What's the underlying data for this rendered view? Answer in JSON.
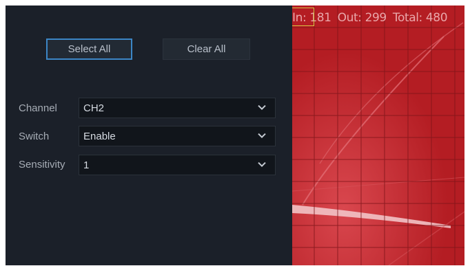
{
  "buttons": {
    "select_all": "Select All",
    "clear_all": "Clear All"
  },
  "fields": [
    {
      "label": "Channel",
      "value": "CH2"
    },
    {
      "label": "Switch",
      "value": "Enable"
    },
    {
      "label": "Sensitivity",
      "value": "1"
    }
  ],
  "counter": {
    "in_label": "In:",
    "in_value": "181",
    "out_label": "Out:",
    "out_value": "299",
    "total_label": "Total:",
    "total_value": "480"
  },
  "icons": {
    "dropdown": "chevron-down-icon"
  },
  "colors": {
    "panel": "#1b2029",
    "video": "#b61e24",
    "grid": "#8a151b",
    "accent": "#3c86c6"
  }
}
